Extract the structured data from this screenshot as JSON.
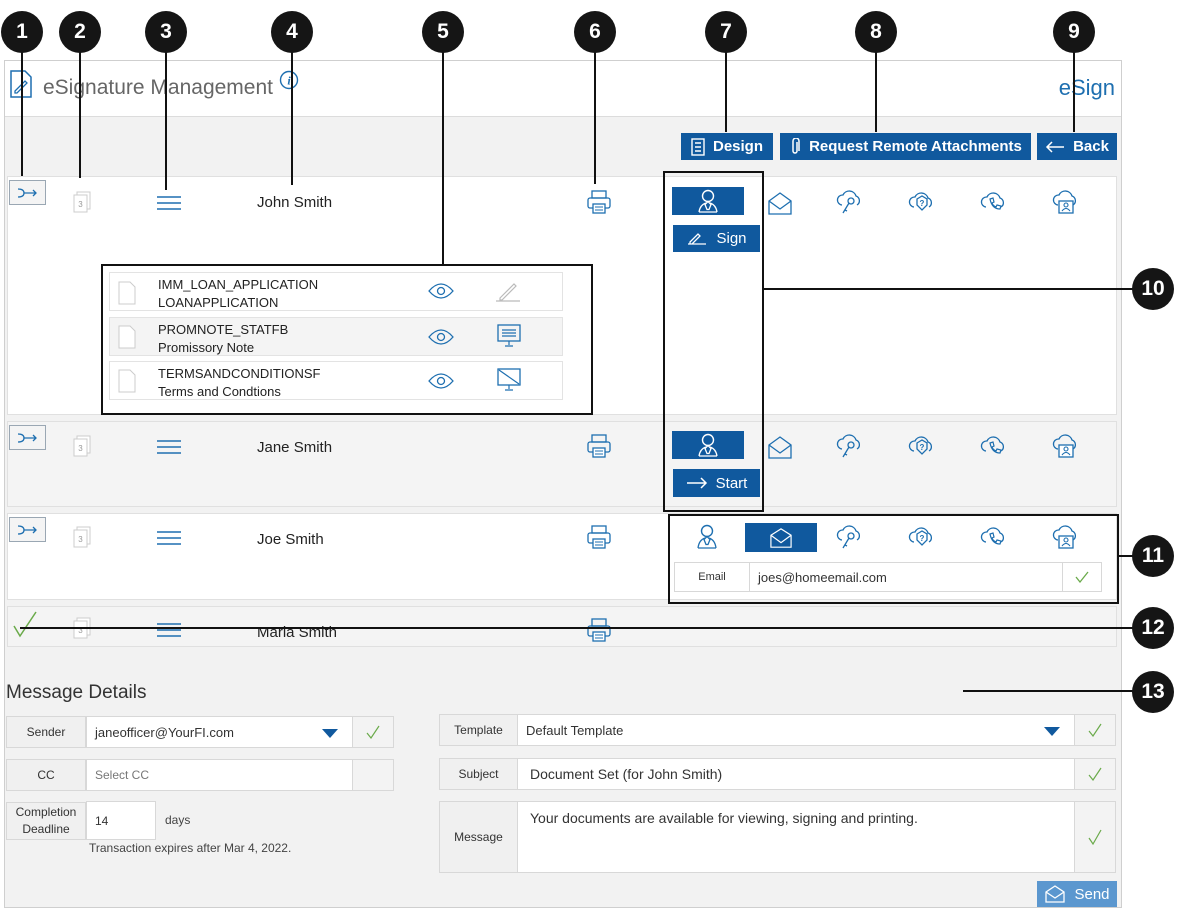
{
  "markers": [
    "1",
    "2",
    "3",
    "4",
    "5",
    "6",
    "7",
    "8",
    "9",
    "10",
    "11",
    "12",
    "13"
  ],
  "header": {
    "title": "eSignature Management",
    "brand": "eSign"
  },
  "toolbar": {
    "design": "Design",
    "request": "Request Remote Attachments",
    "back": "Back"
  },
  "signers": [
    {
      "name": "John Smith"
    },
    {
      "name": "Jane Smith"
    },
    {
      "name": "Joe Smith"
    },
    {
      "name": "Maria Smith"
    }
  ],
  "documents": [
    {
      "code": "IMM_LOAN_APPLICATION",
      "title": "LOANAPPLICATION"
    },
    {
      "code": "PROMNOTE_STATFB",
      "title": "Promissory Note"
    },
    {
      "code": "TERMSANDCONDITIONSF",
      "title": "Terms and Condtions"
    }
  ],
  "signer_actions": {
    "sign": "Sign",
    "start": "Start"
  },
  "email_row": {
    "label": "Email",
    "value": "joes@homeemail.com"
  },
  "message": {
    "heading": "Message Details",
    "sender_label": "Sender",
    "sender_value": "janeofficer@YourFI.com",
    "cc_label": "CC",
    "cc_placeholder": "Select CC",
    "deadline_label": "Completion Deadline",
    "deadline_value": "14",
    "days": "days",
    "expires": "Transaction expires after Mar 4, 2022.",
    "template_label": "Template",
    "template_value": "Default Template",
    "subject_label": "Subject",
    "subject_value": "Document Set (for John Smith)",
    "message_label": "Message",
    "message_value": "Your documents are available for viewing, signing and printing.",
    "send": "Send"
  },
  "colors": {
    "accent": "#10599e",
    "icon": "#1e6fb0",
    "check": "#6aaa4a",
    "marker": "#151515"
  },
  "icons": [
    "route-icon",
    "doc-count-icon",
    "list-icon",
    "printer-icon",
    "person-icon",
    "mail-icon",
    "key-cloud-icon",
    "question-cloud-icon",
    "phone-cloud-icon",
    "id-cloud-icon",
    "eye-icon",
    "sign-icon",
    "monitor-icon",
    "check-icon",
    "send-icon",
    "dropdown-icon",
    "info-icon",
    "paperclip-icon",
    "arrow-left-icon",
    "arrow-right-icon",
    "design-icon"
  ]
}
